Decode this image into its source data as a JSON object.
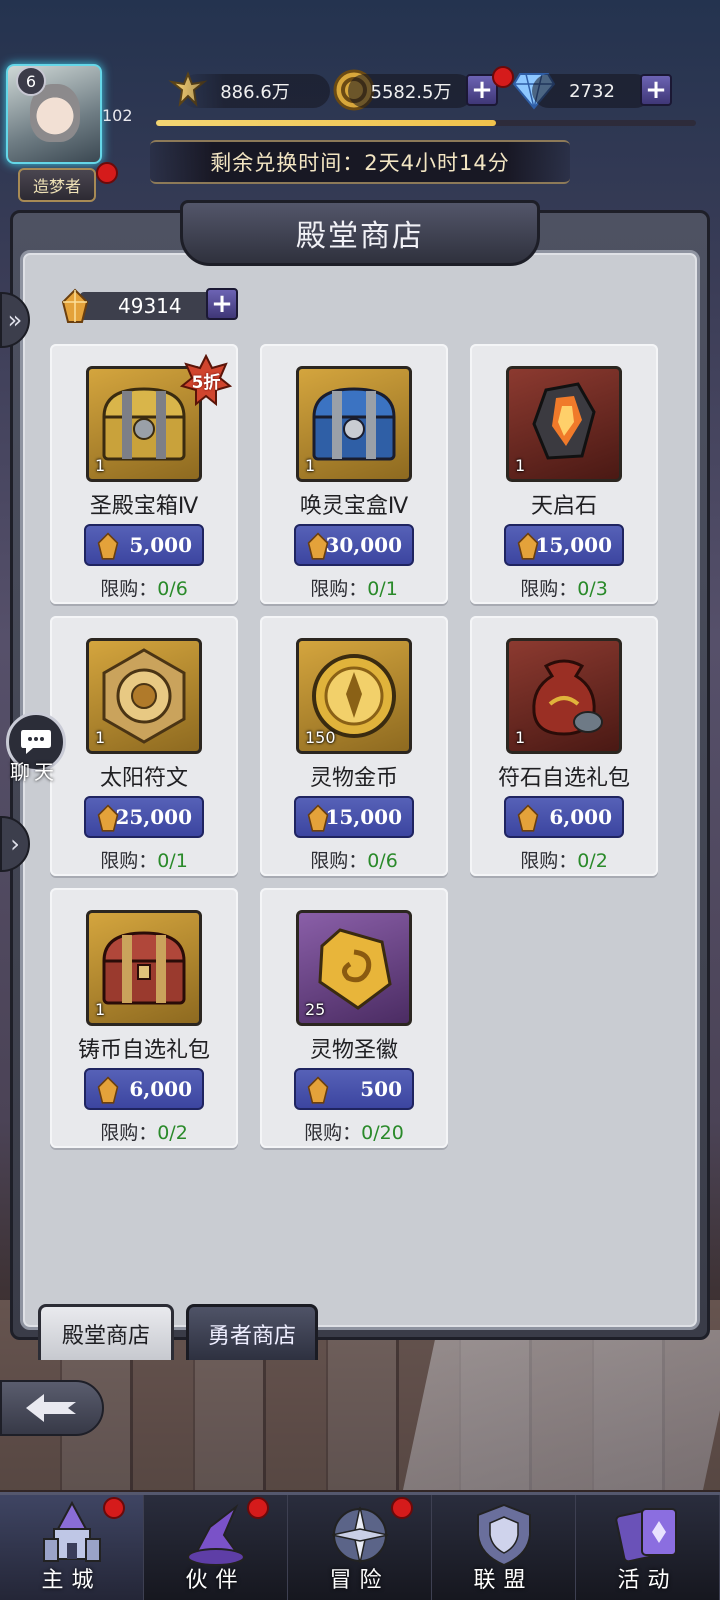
{
  "player": {
    "vip_level": "6",
    "level": "102",
    "title": "造梦者",
    "exp_progress": 0.63
  },
  "resources": {
    "power": "886.6万",
    "gold": "5582.5万",
    "diamonds": "2732"
  },
  "timer_text": "剩余兑换时间：2天4小时14分",
  "shop": {
    "title": "殿堂商店",
    "currency_amount": "49314",
    "limit_label": "限购：",
    "items": [
      {
        "name": "圣殿宝箱Ⅳ",
        "qty": "1",
        "price": "5,000",
        "limit": "0/6",
        "discount": "5折",
        "icon": "gold-chest-icon"
      },
      {
        "name": "唤灵宝盒Ⅳ",
        "qty": "1",
        "price": "30,000",
        "limit": "0/1",
        "icon": "blue-chest-icon"
      },
      {
        "name": "天启石",
        "qty": "1",
        "price": "15,000",
        "limit": "0/3",
        "icon": "ember-stone-icon"
      },
      {
        "name": "太阳符文",
        "qty": "1",
        "price": "25,000",
        "limit": "0/1",
        "icon": "sun-rune-icon"
      },
      {
        "name": "灵物金币",
        "qty": "150",
        "price": "15,000",
        "limit": "0/6",
        "icon": "spirit-coin-icon"
      },
      {
        "name": "符石自选礼包",
        "qty": "1",
        "price": "6,000",
        "limit": "0/2",
        "icon": "rune-bag-icon"
      },
      {
        "name": "铸币自选礼包",
        "qty": "1",
        "price": "6,000",
        "limit": "0/2",
        "icon": "red-chest-icon"
      },
      {
        "name": "灵物圣徽",
        "qty": "25",
        "price": "500",
        "limit": "0/20",
        "icon": "spirit-emblem-icon"
      }
    ]
  },
  "tabs": {
    "active": "殿堂商店",
    "inactive": "勇者商店"
  },
  "chat_label": "聊天",
  "nav": [
    {
      "label": "主城",
      "icon": "castle-icon",
      "badge": true,
      "active": true
    },
    {
      "label": "伙伴",
      "icon": "wizard-hat-icon",
      "badge": true,
      "active": false
    },
    {
      "label": "冒险",
      "icon": "compass-icon",
      "badge": true,
      "active": false
    },
    {
      "label": "联盟",
      "icon": "shield-icon",
      "badge": false,
      "active": false
    },
    {
      "label": "活动",
      "icon": "cards-icon",
      "badge": false,
      "active": false
    }
  ],
  "colors": {
    "accent": "#4a54ab",
    "limit_value": "#2a8a2a",
    "badge": "#d51b1b"
  }
}
